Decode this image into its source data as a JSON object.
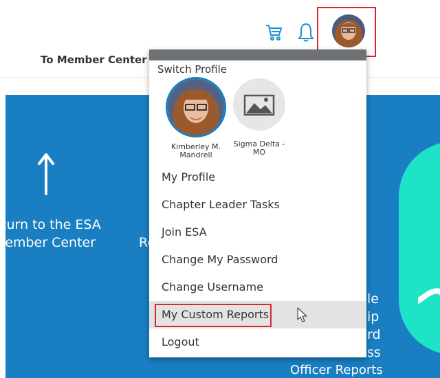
{
  "header": {
    "member_center_link": "To Member Center",
    "icons": [
      "cart-icon",
      "bell-icon",
      "avatar"
    ]
  },
  "hero": {
    "return_line1": "turn to the ESA",
    "return_line2": "lember Center",
    "partial_re": "Re",
    "right_fragments": [
      "le",
      "ip",
      "rd",
      "ss"
    ],
    "officer_reports": "Officer Reports",
    "colors": {
      "background": "#1a7ec2",
      "accent": "#1fe3c6"
    }
  },
  "dropdown": {
    "title": "Switch Profile",
    "profiles": [
      {
        "name_line1": "Kimberley M.",
        "name_line2": "Mandrell"
      },
      {
        "name_line1": "Sigma Delta -",
        "name_line2": "MO"
      }
    ],
    "menu": [
      "My Profile",
      "Chapter Leader Tasks",
      "Join ESA",
      "Change My Password",
      "Change Username",
      "My Custom Reports",
      "Logout"
    ],
    "highlight_color": "#d6282f"
  }
}
